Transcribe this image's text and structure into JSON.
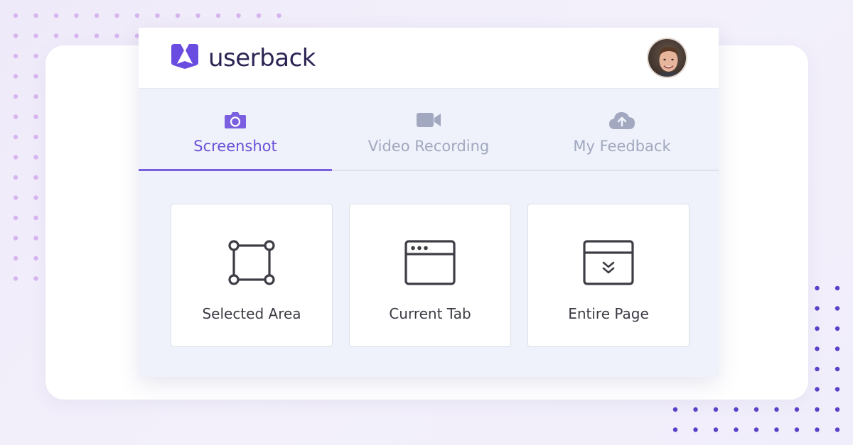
{
  "brand": {
    "name": "userback",
    "logo_icon": "userback-logo-icon",
    "color": "#6b4ce0"
  },
  "user": {
    "avatar_icon": "user-avatar"
  },
  "tabs": [
    {
      "label": "Screenshot",
      "icon": "camera-icon",
      "active": true
    },
    {
      "label": "Video Recording",
      "icon": "video-camera-icon",
      "active": false
    },
    {
      "label": "My Feedback",
      "icon": "cloud-upload-icon",
      "active": false
    }
  ],
  "options": [
    {
      "label": "Selected Area",
      "icon": "selection-area-icon"
    },
    {
      "label": "Current Tab",
      "icon": "browser-window-icon"
    },
    {
      "label": "Entire Page",
      "icon": "full-page-scroll-icon"
    }
  ],
  "colors": {
    "accent": "#7a5fe0",
    "inactive_tab": "#a1a8bf",
    "panel_bg": "#eff2fa"
  }
}
